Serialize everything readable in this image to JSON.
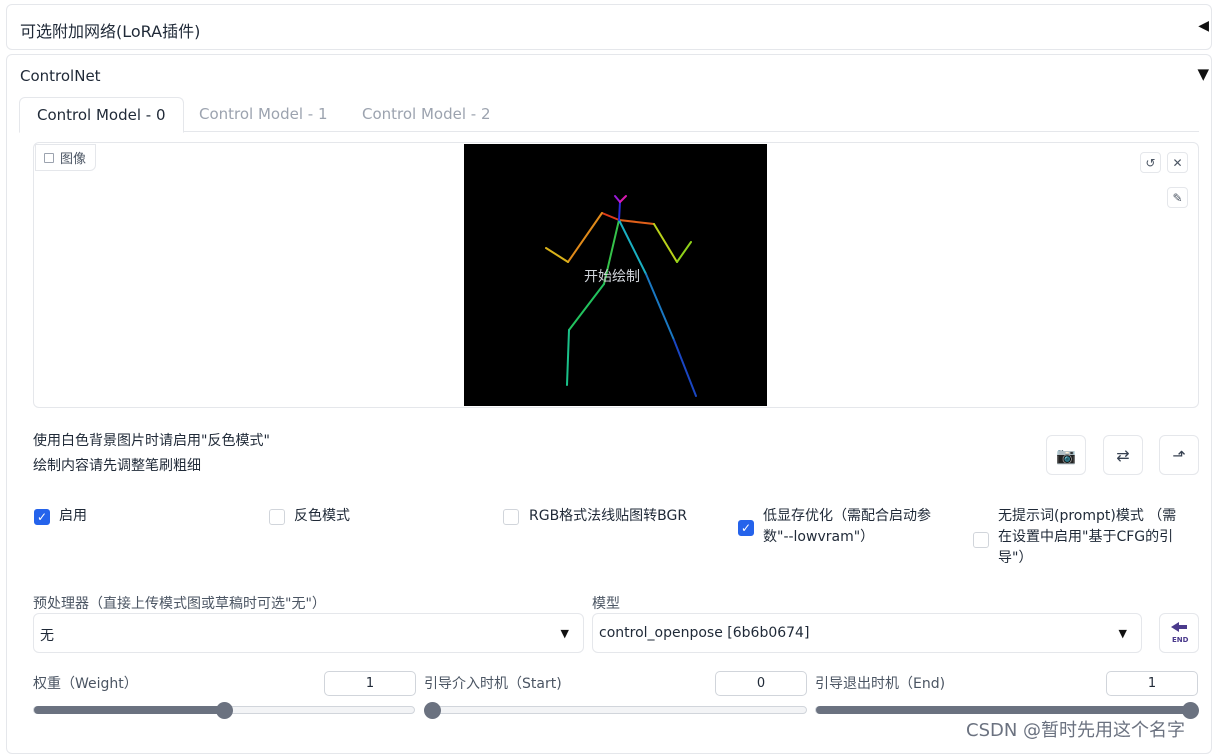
{
  "lora_section": {
    "title": "可选附加网络(LoRA插件)",
    "collapse_icon": "◀"
  },
  "controlnet": {
    "title": "ControlNet",
    "collapse_icon": "▼",
    "tabs": [
      {
        "label": "Control Model - 0",
        "active": true
      },
      {
        "label": "Control Model - 1",
        "active": false
      },
      {
        "label": "Control Model - 2",
        "active": false
      }
    ],
    "image": {
      "label": "图像",
      "overlay_text": "开始绘制"
    },
    "hints": [
      "使用白色背景图片时请启用\"反色模式\"",
      "绘制内容请先调整笔刷粗细"
    ],
    "checkboxes": [
      {
        "label": "启用",
        "checked": true
      },
      {
        "label": "反色模式",
        "checked": false
      },
      {
        "label": "RGB格式法线贴图转BGR",
        "checked": false
      },
      {
        "label": "低显存优化（需配合启动参数\"--lowvram\"）",
        "checked": true
      },
      {
        "label": "无提示词(prompt)模式 （需在设置中启用\"基于CFG的引导\"）",
        "checked": false
      }
    ],
    "preprocessor": {
      "label": "预处理器（直接上传模式图或草稿时可选\"无\"）",
      "value": "无"
    },
    "model": {
      "label": "模型",
      "value": "control_openpose [6b6b0674]"
    },
    "sliders": [
      {
        "label": "权重（Weight）",
        "value": "1",
        "fraction": 0.5
      },
      {
        "label": "引导介入时机（Start)",
        "value": "0",
        "fraction": 0.0
      },
      {
        "label": "引导退出时机（End)",
        "value": "1",
        "fraction": 1.0
      }
    ]
  },
  "watermark": "CSDN @暂时先用这个名字",
  "colors": {
    "accent": "#2563eb",
    "slider": "#6b7280"
  }
}
